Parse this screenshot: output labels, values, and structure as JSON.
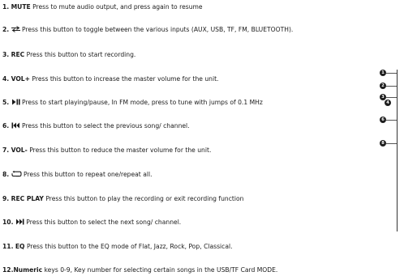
{
  "items": [
    {
      "num": "1.",
      "key": "MUTE",
      "text": " Press to mute audio output, and press again to resume"
    },
    {
      "num": "2.",
      "icon": "toggle-arrows-icon",
      "text": " Press this button to toggle between the various inputs (AUX, USB, TF, FM, BLUETOOTH)."
    },
    {
      "num": "3.",
      "key": "REC",
      "text": " Press this button to start recording."
    },
    {
      "num": "4.",
      "key": "VOL+",
      "text": " Press this button to increase the master volume for the unit."
    },
    {
      "num": "5.",
      "icon": "play-pause-icon",
      "text": "  Press to start playing/pause, In FM mode, press to tune with jumps of 0.1 MHz"
    },
    {
      "num": "6.",
      "icon": "previous-icon",
      "text": "  Press this button to select the previous song/ channel."
    },
    {
      "num": "7.",
      "key": "VOL-",
      "text": " Press this button to reduce the master volume for the unit."
    },
    {
      "num": "8.",
      "icon": "repeat-icon",
      "text": " Press this button to repeat one/repeat all."
    },
    {
      "num": "9.",
      "key": "REC PLAY",
      "text": " Press this button to play the recording or exit recording function"
    },
    {
      "num": "10.",
      "icon": "next-icon",
      "text": " Press this button to select the next song/ channel."
    },
    {
      "num": "11.",
      "key": "EQ",
      "text": " Press this button to the EQ mode of Flat, Jazz, Rock, Pop, Classical."
    },
    {
      "num": "12.",
      "key": "Numeric",
      "text": " keys 0-9, Key number for selecting certain songs in the USB/TF Card MODE."
    }
  ],
  "callouts": [
    {
      "label": "1"
    },
    {
      "label": "2"
    },
    {
      "label": "3"
    },
    {
      "label": "4"
    },
    {
      "label": "6"
    },
    {
      "label": "8"
    }
  ]
}
